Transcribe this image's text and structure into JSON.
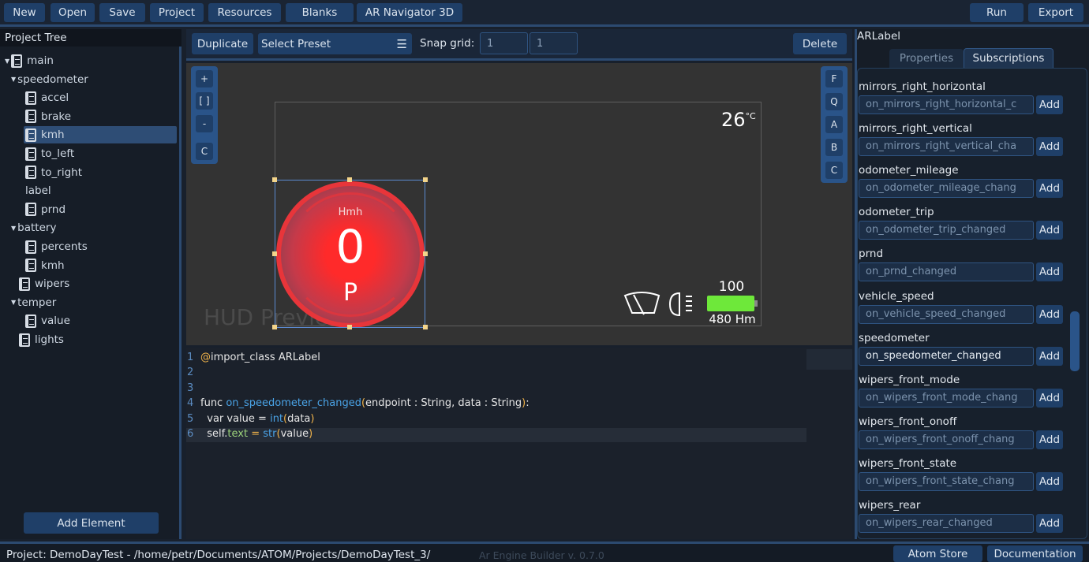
{
  "toolbar": {
    "left": [
      "New",
      "Open",
      "Save",
      "Project",
      "Resources",
      "Blanks",
      "AR Navigator 3D"
    ],
    "run": "Run",
    "export": "Export"
  },
  "tree": {
    "title": "Project Tree",
    "items": [
      {
        "label": "main",
        "level": 0,
        "arrow": true,
        "icon": true
      },
      {
        "label": "speedometer",
        "level": 1,
        "arrow": true,
        "icon": false
      },
      {
        "label": "accel",
        "level": 2,
        "arrow": false,
        "icon": true
      },
      {
        "label": "brake",
        "level": 2,
        "arrow": false,
        "icon": true
      },
      {
        "label": "kmh",
        "level": 2,
        "arrow": false,
        "icon": true,
        "selected": true
      },
      {
        "label": "to_left",
        "level": 2,
        "arrow": false,
        "icon": true
      },
      {
        "label": "to_right",
        "level": 2,
        "arrow": false,
        "icon": true
      },
      {
        "label": "label",
        "level": 2,
        "arrow": false,
        "icon": false
      },
      {
        "label": "prnd",
        "level": 2,
        "arrow": false,
        "icon": true
      },
      {
        "label": "battery",
        "level": 1,
        "arrow": true,
        "icon": false
      },
      {
        "label": "percents",
        "level": 2,
        "arrow": false,
        "icon": true
      },
      {
        "label": "kmh",
        "level": 2,
        "arrow": false,
        "icon": true
      },
      {
        "label": "wipers",
        "level": 1,
        "arrow": false,
        "icon": true
      },
      {
        "label": "temper",
        "level": 1,
        "arrow": true,
        "icon": false
      },
      {
        "label": "value",
        "level": 2,
        "arrow": false,
        "icon": true
      },
      {
        "label": "lights",
        "level": 1,
        "arrow": false,
        "icon": true
      }
    ],
    "add_element": "Add Element"
  },
  "editor": {
    "duplicate": "Duplicate",
    "preset": "Select Preset",
    "snap_label": "Snap grid:",
    "snap_x": "1",
    "snap_y": "1",
    "delete": "Delete",
    "left_tools": [
      "+",
      "[ ]",
      "-",
      "C"
    ],
    "right_tools": [
      "F",
      "Q",
      "A",
      "B",
      "C"
    ]
  },
  "hud": {
    "temp": "26",
    "temp_unit": "°C",
    "speed_unit": "Hmh",
    "speed": "0",
    "gear": "P",
    "battery_percent": 100,
    "battery_label": "100",
    "range": "480 Hm",
    "watermark": "HUD Preview",
    "battery_color": "#6ee83a",
    "gauge_color": "#e8353a"
  },
  "code": {
    "lines": [
      [
        {
          "t": "@",
          "c": "yl"
        },
        {
          "t": "import_class ARLabel",
          "c": "kw"
        }
      ],
      [],
      [],
      [
        {
          "t": "func ",
          "c": "kw"
        },
        {
          "t": "on_speedometer_changed",
          "c": "fn"
        },
        {
          "t": "(",
          "c": "yl"
        },
        {
          "t": "endpoint : String, data : String",
          "c": "kw"
        },
        {
          "t": ")",
          "c": "yl"
        },
        {
          "t": ":",
          "c": "kw"
        }
      ],
      [
        {
          "t": "  var value = ",
          "c": "kw"
        },
        {
          "t": "int",
          "c": "fn"
        },
        {
          "t": "(",
          "c": "yl"
        },
        {
          "t": "data",
          "c": "kw"
        },
        {
          "t": ")",
          "c": "yl"
        }
      ],
      [
        {
          "t": "  self.",
          "c": "kw"
        },
        {
          "t": "text",
          "c": "gr"
        },
        {
          "t": " = ",
          "c": "yl"
        },
        {
          "t": "str",
          "c": "fn"
        },
        {
          "t": "(",
          "c": "yl"
        },
        {
          "t": "value",
          "c": "kw"
        },
        {
          "t": ")",
          "c": "yl"
        }
      ]
    ]
  },
  "inspector": {
    "title": "ARLabel",
    "tabs": [
      "Properties",
      "Subscriptions"
    ],
    "active_tab": "Subscriptions",
    "add": "Add",
    "subs": [
      {
        "name": "mirrors_right_horizontal",
        "value": "on_mirrors_right_horizontal_c"
      },
      {
        "name": "mirrors_right_vertical",
        "value": "on_mirrors_right_vertical_cha"
      },
      {
        "name": "odometer_mileage",
        "value": "on_odometer_mileage_chang"
      },
      {
        "name": "odometer_trip",
        "value": "on_odometer_trip_changed"
      },
      {
        "name": "prnd",
        "value": "on_prnd_changed"
      },
      {
        "name": "vehicle_speed",
        "value": "on_vehicle_speed_changed"
      },
      {
        "name": "speedometer",
        "value": "on_speedometer_changed",
        "active": true
      },
      {
        "name": "wipers_front_mode",
        "value": "on_wipers_front_mode_chang"
      },
      {
        "name": "wipers_front_onoff",
        "value": "on_wipers_front_onoff_chang"
      },
      {
        "name": "wipers_front_state",
        "value": "on_wipers_front_state_chang"
      },
      {
        "name": "wipers_rear",
        "value": "on_wipers_rear_changed"
      }
    ]
  },
  "status": {
    "project": "Project: DemoDayTest - /home/petr/Documents/ATOM/Projects/DemoDayTest_3/",
    "version": "Ar Engine Builder v. 0.7.0",
    "atom_store": "Atom Store",
    "documentation": "Documentation"
  }
}
